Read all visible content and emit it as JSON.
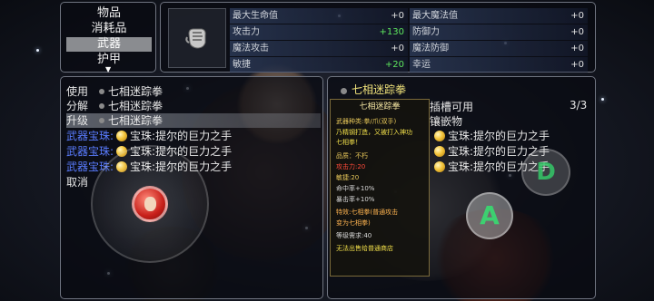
{
  "category_menu": {
    "items": [
      "物品",
      "消耗品",
      "武器",
      "护甲"
    ],
    "selected_index": 2
  },
  "stats": {
    "left": [
      {
        "label": "最大生命值",
        "value": "+0",
        "color": "white"
      },
      {
        "label": "攻击力",
        "value": "+130",
        "color": "green"
      },
      {
        "label": "魔法攻击",
        "value": "+0",
        "color": "white"
      },
      {
        "label": "敏捷",
        "value": "+20",
        "color": "green"
      }
    ],
    "right": [
      {
        "label": "最大魔法值",
        "value": "+0",
        "color": "white"
      },
      {
        "label": "防御力",
        "value": "+0",
        "color": "white"
      },
      {
        "label": "魔法防御",
        "value": "+0",
        "color": "white"
      },
      {
        "label": "幸运",
        "value": "+0",
        "color": "white"
      }
    ]
  },
  "actions": {
    "equip_label": "使用",
    "split_label": "分解",
    "upgrade_label": "升级",
    "weapon_name": "七相迷踪拳",
    "gem_label": "武器宝珠:",
    "gem_name": "宝珠:提尔的巨力之手",
    "cancel_label": "取消"
  },
  "detail": {
    "title": "七相迷踪拳",
    "tooltip": {
      "name": "七相迷踪拳",
      "type_line": "武器种类:拳/爪(双手)",
      "desc1": "乃精钢打造，又被打入神功",
      "desc2": "七相拳！",
      "quality": "品质：不朽",
      "atk": "攻击力:20",
      "agi": "敏捷:20",
      "hit": "命中率+10%",
      "crit": "暴击率+10%",
      "special1": "特效:七相拳(普通攻击",
      "special2": "变为七相拳)",
      "level": "等级需求:40",
      "warning": "无法出售给普通商店"
    },
    "slot_label": "插槽可用",
    "slot_count": "3/3",
    "inlay_label": "镶嵌物",
    "gems": [
      "宝珠:提尔的巨力之手",
      "宝珠:提尔的巨力之手",
      "宝珠:提尔的巨力之手"
    ]
  },
  "buttons": {
    "a": "A",
    "d": "D"
  },
  "colors": {
    "stat_green": "#5ee65e",
    "gem_blue": "#5a7cff",
    "title_gold": "#f0e27a",
    "tooltip_red": "#ff4a3a"
  }
}
